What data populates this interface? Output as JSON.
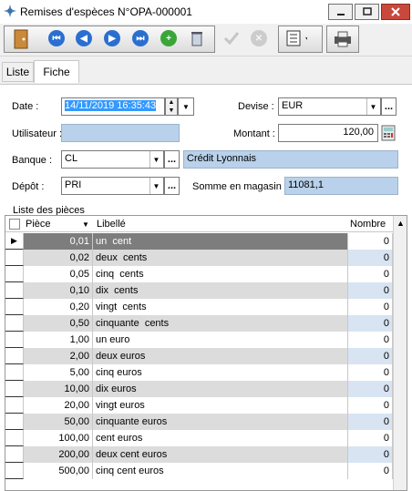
{
  "window": {
    "title": "Remises d'espèces N°OPA-000001",
    "minimize": "—",
    "maximize": "▢",
    "close": "✕"
  },
  "toolbar": {
    "icons": [
      "door-icon",
      "first-icon",
      "prev-icon",
      "next-icon",
      "last-icon",
      "add-icon",
      "delete-icon",
      "validate-icon",
      "cancel-icon",
      "list-menu-icon",
      "print-icon"
    ]
  },
  "tabs": [
    {
      "label": "Liste"
    },
    {
      "label": "Fiche"
    }
  ],
  "form": {
    "date_label": "Date :",
    "date_value": "14/11/2019 16:35:43",
    "devise_label": "Devise :",
    "devise_value": "EUR",
    "utilisateur_label": "Utilisateur :",
    "utilisateur_value": "",
    "montant_label": "Montant :",
    "montant_value": "120,00",
    "banque_label": "Banque :",
    "banque_value": "CL",
    "banque_name": "Crédit Lyonnais",
    "depot_label": "Dépôt :",
    "depot_value": "PRI",
    "somme_label": "Somme en magasin :",
    "somme_value": "11081,1",
    "dots": "..."
  },
  "grid": {
    "title": "Liste des pièces",
    "columns": [
      "Pièce",
      "Libellé",
      "Nombre"
    ],
    "rows": [
      {
        "piece": "0,01",
        "libelle": "un  cent",
        "nombre": "0"
      },
      {
        "piece": "0,02",
        "libelle": "deux  cents",
        "nombre": "0"
      },
      {
        "piece": "0,05",
        "libelle": "cinq  cents",
        "nombre": "0"
      },
      {
        "piece": "0,10",
        "libelle": "dix  cents",
        "nombre": "0"
      },
      {
        "piece": "0,20",
        "libelle": "vingt  cents",
        "nombre": "0"
      },
      {
        "piece": "0,50",
        "libelle": "cinquante  cents",
        "nombre": "0"
      },
      {
        "piece": "1,00",
        "libelle": "un euro",
        "nombre": "0"
      },
      {
        "piece": "2,00",
        "libelle": "deux euros",
        "nombre": "0"
      },
      {
        "piece": "5,00",
        "libelle": "cinq euros",
        "nombre": "0"
      },
      {
        "piece": "10,00",
        "libelle": "dix euros",
        "nombre": "0"
      },
      {
        "piece": "20,00",
        "libelle": "vingt euros",
        "nombre": "0"
      },
      {
        "piece": "50,00",
        "libelle": "cinquante euros",
        "nombre": "0"
      },
      {
        "piece": "100,00",
        "libelle": "cent euros",
        "nombre": "0"
      },
      {
        "piece": "200,00",
        "libelle": "deux cent euros",
        "nombre": "0"
      },
      {
        "piece": "500,00",
        "libelle": "cinq cent euros",
        "nombre": "0"
      }
    ],
    "selected_row": 0
  },
  "colors": {
    "selected_row": "#7d7d7d",
    "alt_row": "#dcdcdc",
    "blue_field": "#b9d1ea",
    "nombre_alt": "#d8e4f2"
  }
}
